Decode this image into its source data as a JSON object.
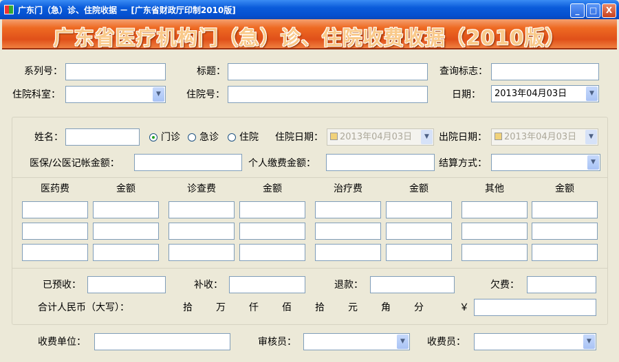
{
  "window": {
    "title": "广东门（急）诊、住院收据 － [广东省财政厅印制2010版]",
    "minimize": "_",
    "maximize": "□",
    "close": "X"
  },
  "banner": {
    "title": "广东省医疗机构门（急）诊、住院收费收据（2010版）"
  },
  "header": {
    "serial_label": "系列号：",
    "title_label": "标题：",
    "query_flag_label": "查询标志：",
    "dept_label": "住院科室：",
    "inpatient_no_label": "住院号：",
    "date_label": "日期：",
    "date_value": "2013年04月03日"
  },
  "patient": {
    "name_label": "姓名：",
    "radios": [
      {
        "label": "门诊",
        "checked": true
      },
      {
        "label": "急诊",
        "checked": false
      },
      {
        "label": "住院",
        "checked": false
      }
    ],
    "admit_date_label": "住院日期：",
    "admit_date_value": "2013年04月03日",
    "discharge_date_label": "出院日期：",
    "discharge_date_value": "2013年04月03日",
    "insurance_label": "医保/公医记帐金额：",
    "personal_label": "个人缴费金额：",
    "settle_label": "结算方式："
  },
  "fees": {
    "headers": [
      "医药费",
      "金额",
      "诊查费",
      "金额",
      "治疗费",
      "金额",
      "其他",
      "金额"
    ]
  },
  "totals": {
    "prepaid_label": "已预收：",
    "supplement_label": "补收：",
    "refund_label": "退款：",
    "owed_label": "欠费：",
    "total_label": "合计人民币（大写）：",
    "units": [
      "拾",
      "万",
      "仟",
      "佰",
      "拾",
      "元",
      "角",
      "分"
    ],
    "yen": "￥"
  },
  "footer": {
    "unit_label": "收费单位：",
    "auditor_label": "审核员：",
    "cashier_label": "收费员："
  },
  "icons": {
    "dropdown": "▼"
  }
}
